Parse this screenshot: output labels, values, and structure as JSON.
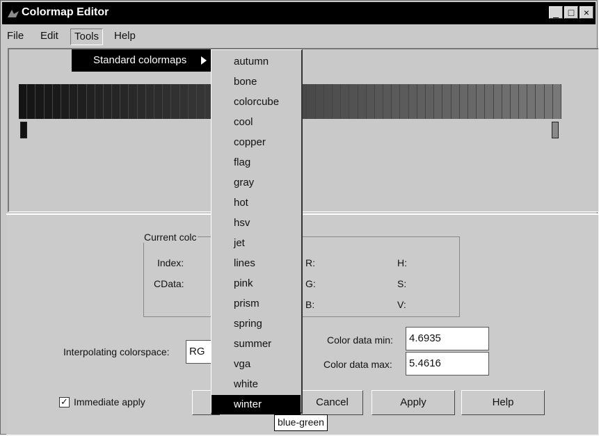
{
  "window": {
    "title": "Colormap Editor"
  },
  "window_buttons": [
    "_",
    "□",
    "×"
  ],
  "menubar": [
    "File",
    "Edit",
    "Tools",
    "Help"
  ],
  "tools_submenu": {
    "label": "Standard colormaps"
  },
  "colormaps": [
    "autumn",
    "bone",
    "colorcube",
    "cool",
    "copper",
    "flag",
    "gray",
    "hot",
    "hsv",
    "jet",
    "lines",
    "pink",
    "prism",
    "spring",
    "summer",
    "vga",
    "white",
    "winter"
  ],
  "tooltip": "blue-green",
  "current_color": {
    "group_title": "Current colc",
    "index_label": "Index:",
    "cdata_label": "CData:",
    "r_label": "R:",
    "g_label": "G:",
    "b_label": "B:",
    "h_label": "H:",
    "s_label": "S:",
    "v_label": "V:"
  },
  "interpolation": {
    "label": "Interpolating colorspace:",
    "value": "RG"
  },
  "color_data": {
    "min_label": "Color data min:",
    "min_value": "4.6935",
    "max_label": "Color data max:",
    "max_value": "5.4616"
  },
  "immediate_apply": {
    "label": "Immediate apply",
    "checked": true,
    "checkmark": "✓"
  },
  "buttons": {
    "cancel": "Cancel",
    "apply": "Apply",
    "help": "Help"
  }
}
